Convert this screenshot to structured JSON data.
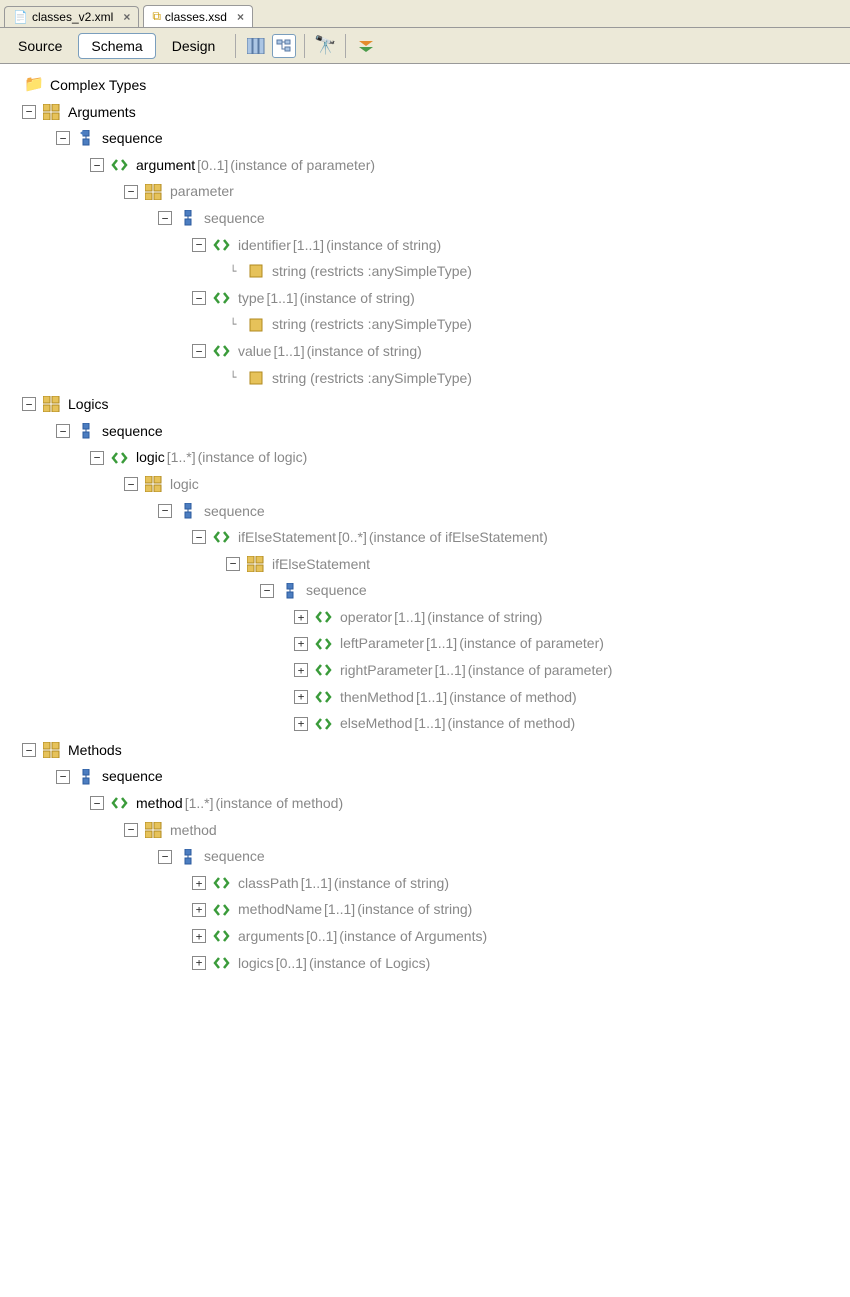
{
  "tabs": [
    {
      "label": "classes_v2.xml",
      "active": false
    },
    {
      "label": "classes.xsd",
      "active": true
    }
  ],
  "toolbar": {
    "source": "Source",
    "schema": "Schema",
    "design": "Design"
  },
  "root_label": "Complex Types",
  "nodes": {
    "arguments": "Arguments",
    "sequence": "sequence",
    "argument": "argument",
    "argument_card": "[0..1]",
    "argument_desc": "(instance of parameter)",
    "parameter": "parameter",
    "identifier": "identifier",
    "identifier_card": "[1..1]",
    "identifier_desc": "(instance of string)",
    "string_restrict": "string (restricts :anySimpleType)",
    "type": "type",
    "type_card": "[1..1]",
    "type_desc": "(instance of string)",
    "value": "value",
    "value_card": "[1..1]",
    "value_desc": "(instance of string)",
    "logics": "Logics",
    "logic": "logic",
    "logic_card": "[1..*]",
    "logic_desc": "(instance of logic)",
    "logic_type": "logic",
    "ifelse": "ifElseStatement",
    "ifelse_card": "[0..*]",
    "ifelse_desc": "(instance of ifElseStatement)",
    "ifelse_type": "ifElseStatement",
    "operator": "operator",
    "operator_card": "[1..1]",
    "operator_desc": "(instance of string)",
    "leftparam": "leftParameter",
    "leftparam_card": "[1..1]",
    "leftparam_desc": "(instance of parameter)",
    "rightparam": "rightParameter",
    "rightparam_card": "[1..1]",
    "rightparam_desc": "(instance of parameter)",
    "thenmethod": "thenMethod",
    "thenmethod_card": "[1..1]",
    "thenmethod_desc": "(instance of method)",
    "elsemethod": "elseMethod",
    "elsemethod_card": "[1..1]",
    "elsemethod_desc": "(instance of method)",
    "methods": "Methods",
    "method": "method",
    "method_card": "[1..*]",
    "method_desc": "(instance of method)",
    "method_type": "method",
    "classpath": "classPath",
    "classpath_card": "[1..1]",
    "classpath_desc": "(instance of string)",
    "methodname": "methodName",
    "methodname_card": "[1..1]",
    "methodname_desc": "(instance of string)",
    "arguments_el": "arguments",
    "arguments_card": "[0..1]",
    "arguments_desc": "(instance of Arguments)",
    "logics_el": "logics",
    "logics_card": "[0..1]",
    "logics_desc": "(instance of Logics)"
  }
}
